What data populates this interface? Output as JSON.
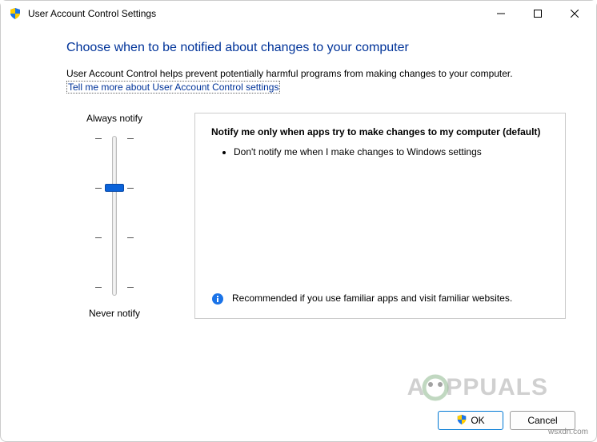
{
  "window": {
    "title": "User Account Control Settings"
  },
  "page": {
    "heading": "Choose when to be notified about changes to your computer",
    "description": "User Account Control helps prevent potentially harmful programs from making changes to your computer.",
    "help_link": "Tell me more about User Account Control settings"
  },
  "slider": {
    "top_label": "Always notify",
    "bottom_label": "Never notify",
    "level_count": 4,
    "current_level": 2
  },
  "info": {
    "title": "Notify me only when apps try to make changes to my computer (default)",
    "bullets": [
      "Don't notify me when I make changes to Windows settings"
    ],
    "recommendation": "Recommended if you use familiar apps and visit familiar websites."
  },
  "buttons": {
    "ok": "OK",
    "cancel": "Cancel"
  },
  "watermark": "wsxdn.com",
  "brand_text": "PPUALS"
}
